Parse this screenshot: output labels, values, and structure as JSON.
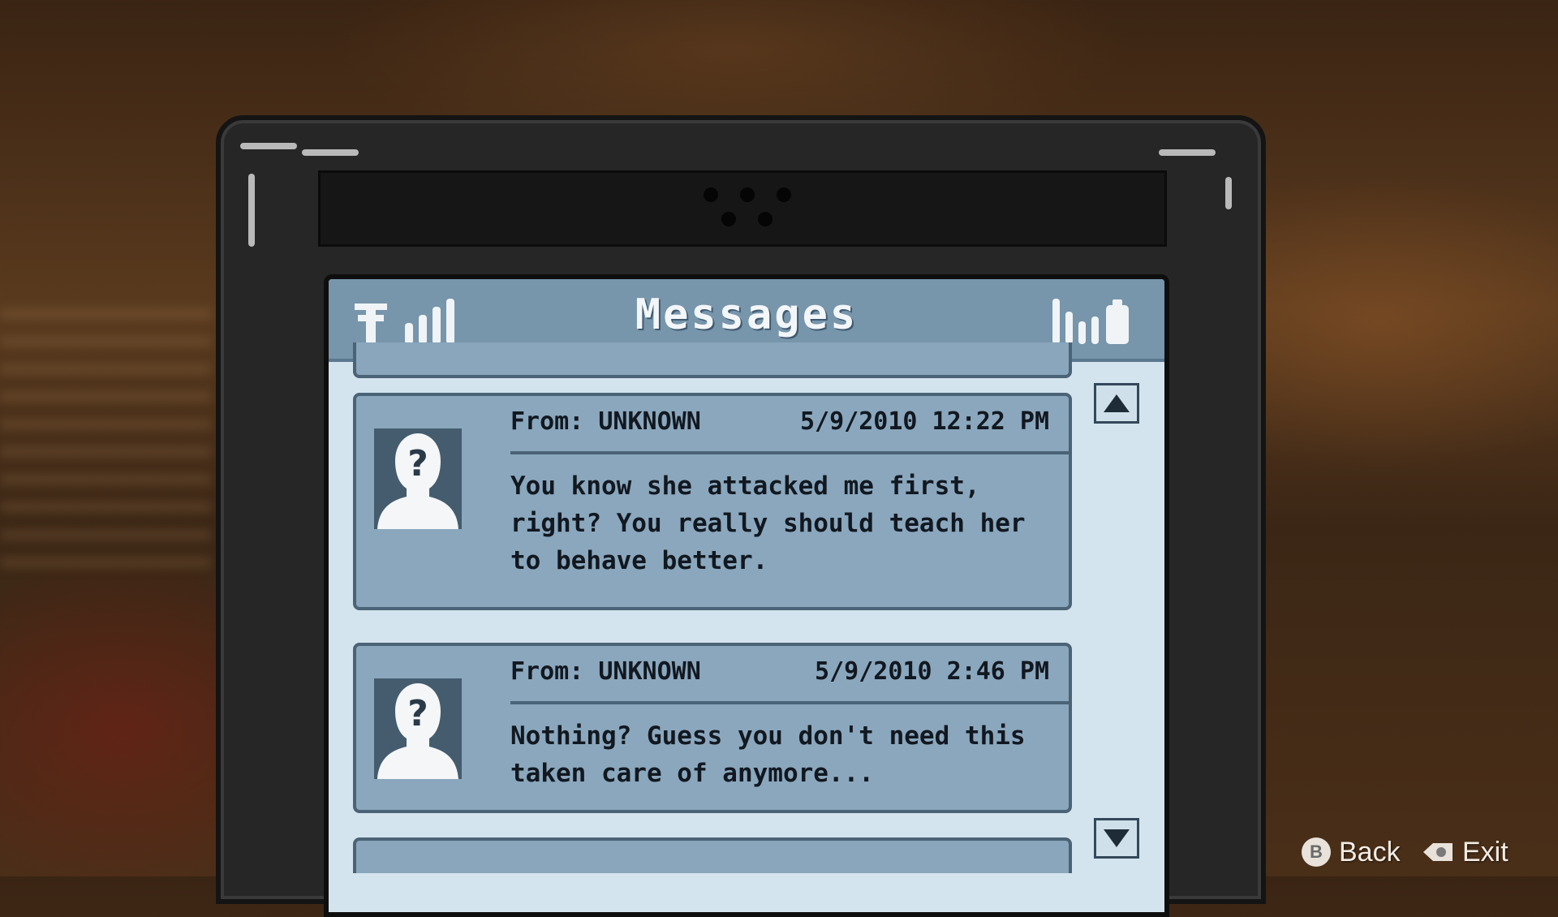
{
  "screen": {
    "title": "Messages",
    "icons": {
      "antenna": "antenna-icon",
      "signal": "signal-bars-icon",
      "battery": "battery-icon"
    }
  },
  "messages": [
    {
      "from": "From: UNKNOWN",
      "time": "5/9/2010 12:22 PM",
      "body": "You know she attacked me first,\nright? You really should teach her\nto behave better.",
      "avatar": "unknown-contact-icon"
    },
    {
      "from": "From: UNKNOWN",
      "time": "5/9/2010 2:46 PM",
      "body": "Nothing? Guess you don't need this\ntaken care of anymore...",
      "avatar": "unknown-contact-icon"
    }
  ],
  "scroll": {
    "up_icon": "scroll-up-icon",
    "down_icon": "scroll-down-icon"
  },
  "prompts": {
    "back_button_glyph": "B",
    "back_label": "Back",
    "exit_label": "Exit"
  },
  "colors": {
    "status_bar": "#7795ab",
    "screen_bg": "#d4e4ee",
    "message_bg": "#8aa7bd",
    "phone_body": "#262626"
  }
}
